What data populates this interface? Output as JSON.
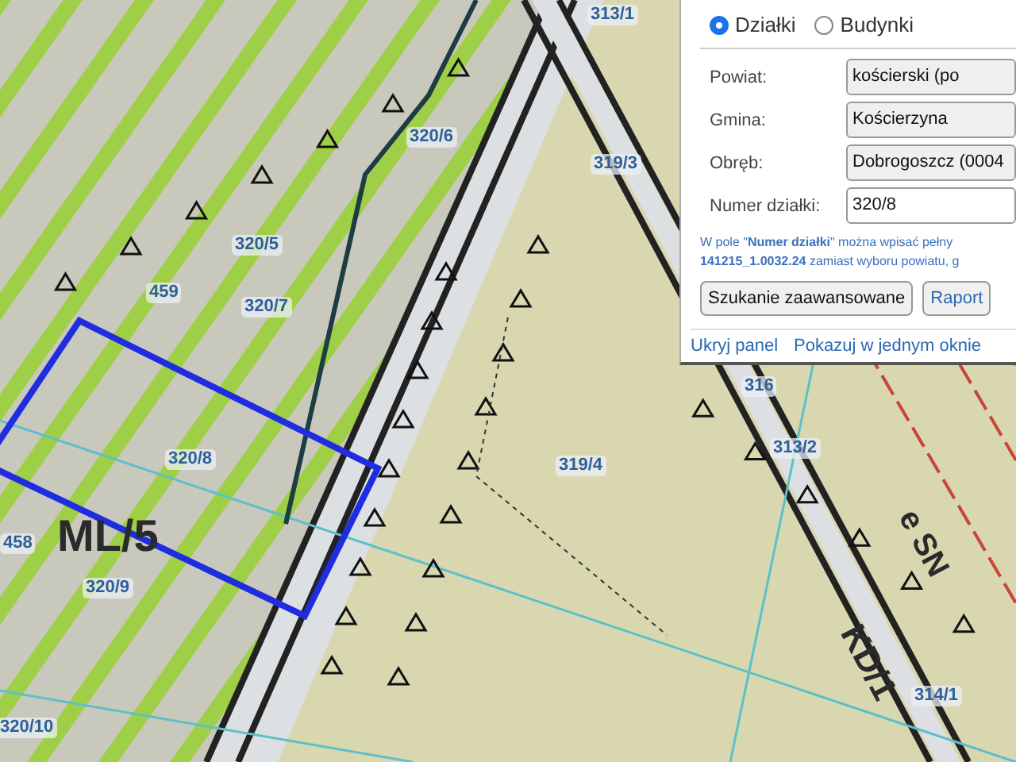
{
  "map": {
    "parcel_labels": [
      "459",
      "458",
      "320/5",
      "320/6",
      "320/7",
      "320/8",
      "320/9",
      "320/10",
      "319/3",
      "313/1",
      "316",
      "313/2",
      "319/4",
      "314/1"
    ],
    "zone_labels": [
      "ML/5",
      "KD/1",
      "e SN"
    ]
  },
  "panel": {
    "search_types": [
      {
        "label": "Działki",
        "selected": true
      },
      {
        "label": "Budynki",
        "selected": false
      }
    ],
    "fields": [
      {
        "label": "Powiat:",
        "kind": "select",
        "value": "kościerski (po"
      },
      {
        "label": "Gmina:",
        "kind": "select",
        "value": "Kościerzyna"
      },
      {
        "label": "Obręb:",
        "kind": "select",
        "value": "Dobrogoszcz (0004"
      },
      {
        "label": "Numer działki:",
        "kind": "input",
        "value": "320/8"
      }
    ],
    "hint_lines": [
      "W pole \"**Numer działki**\" można wpisać pełny",
      "**141215_1.0032.24** zamiast wyboru powiatu, g"
    ],
    "buttons": [
      "Szukanie zaawansowane",
      "Raport"
    ],
    "links": [
      "Ukryj panel",
      "Pokazuj w jednym oknie"
    ]
  }
}
